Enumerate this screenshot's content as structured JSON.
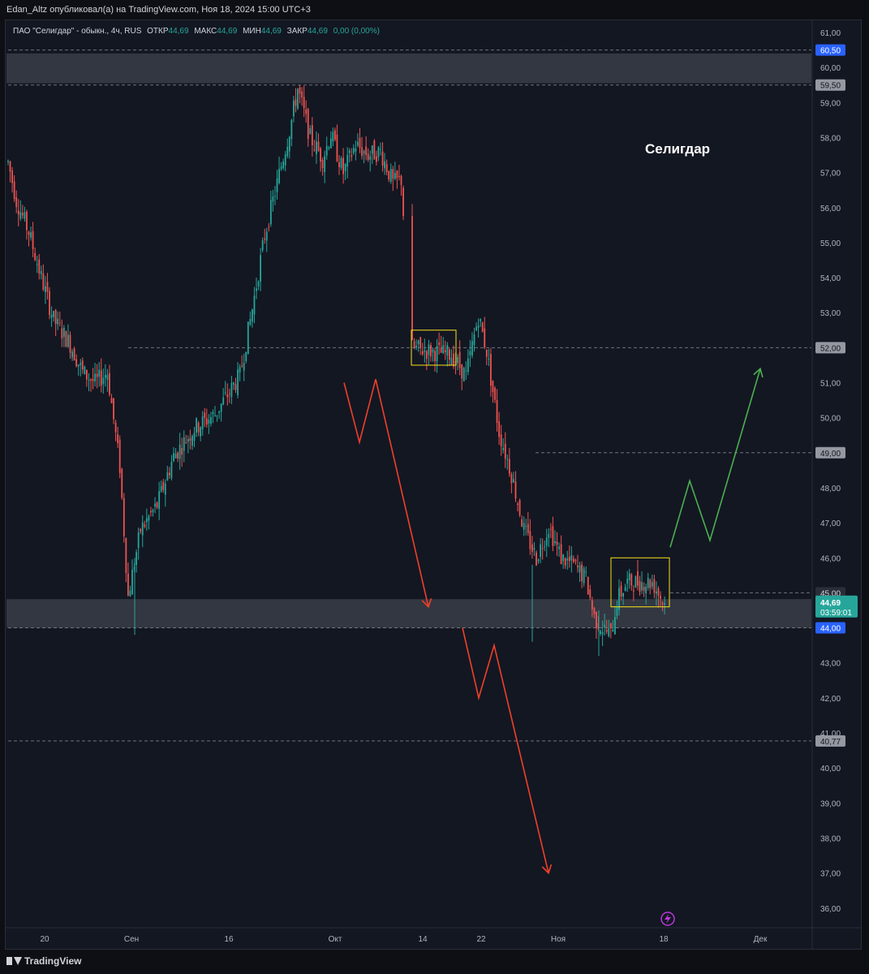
{
  "header": {
    "publisher_line": "Edan_Altz опубликовал(а) на TradingView.com, Ноя 18, 2024 15:00 UTC+3"
  },
  "legend": {
    "symbol": "ПАО \"Селигдар\" - обыкн., 4ч, RUS",
    "open_label": "ОТКР",
    "open_value": "44,69",
    "high_label": "МАКС",
    "high_value": "44,69",
    "low_label": "МИН",
    "low_value": "44,69",
    "close_label": "ЗАКР",
    "close_value": "44,69",
    "change": "0,00 (0,00%)"
  },
  "annotation": {
    "title": "Селигдар"
  },
  "footer": {
    "brand": "TradingView"
  },
  "colors": {
    "background": "#131722",
    "up": "#26a69a",
    "down": "#ef5350",
    "arrow_down": "#f0402a",
    "arrow_up": "#4caf50",
    "box": "#f7e11b",
    "price_tag": "#26a69a",
    "blue_tag": "#2962ff"
  },
  "chart_data": {
    "type": "candlestick",
    "timeframe": "4ч",
    "y_axis": {
      "range": [
        35.5,
        61.5
      ],
      "ticks": [
        "61,00",
        "60,00",
        "59,00",
        "58,00",
        "57,00",
        "56,00",
        "55,00",
        "54,00",
        "53,00",
        "52,00",
        "51,00",
        "50,00",
        "49,00",
        "48,00",
        "47,00",
        "46,00",
        "45,00",
        "44,00",
        "43,00",
        "42,00",
        "41,00",
        "40,00",
        "39,00",
        "38,00",
        "37,00",
        "36,00"
      ]
    },
    "x_axis": {
      "ticks": [
        "20",
        "Сен",
        "16",
        "Окт",
        "14",
        "22",
        "Ноя",
        "18",
        "Дек"
      ]
    },
    "price_levels": [
      {
        "label": "60,50",
        "value": 60.5,
        "style": "highlight"
      },
      {
        "label": "59,50",
        "value": 59.5,
        "style": "grey"
      },
      {
        "label": "52,00",
        "value": 52.0,
        "style": "grey"
      },
      {
        "label": "49,00",
        "value": 49.0,
        "style": "grey"
      },
      {
        "label": "45,00",
        "value": 45.0,
        "style": "dark"
      },
      {
        "label": "44,00",
        "value": 44.0,
        "style": "highlight"
      },
      {
        "label": "40,77",
        "value": 40.77,
        "style": "grey"
      }
    ],
    "current_price": {
      "value": "44,69",
      "countdown": "03:59:01"
    },
    "zones": [
      {
        "name": "resistance-zone",
        "from": 59.55,
        "to": 60.4
      },
      {
        "name": "support-zone",
        "from": 44.0,
        "to": 44.82
      }
    ],
    "price_path": [
      [
        0,
        57.3
      ],
      [
        4,
        56.2
      ],
      [
        10,
        55.3
      ],
      [
        16,
        54.0
      ],
      [
        22,
        52.8
      ],
      [
        30,
        52.1
      ],
      [
        36,
        51.3
      ],
      [
        42,
        51.0
      ],
      [
        48,
        51.3
      ],
      [
        54,
        48.6
      ],
      [
        58,
        44.9
      ],
      [
        64,
        46.8
      ],
      [
        72,
        47.5
      ],
      [
        80,
        48.9
      ],
      [
        90,
        49.7
      ],
      [
        100,
        50.1
      ],
      [
        112,
        51.2
      ],
      [
        118,
        53.1
      ],
      [
        124,
        55.2
      ],
      [
        130,
        56.7
      ],
      [
        136,
        58.2
      ],
      [
        140,
        59.4
      ],
      [
        146,
        58.0
      ],
      [
        152,
        57.4
      ],
      [
        156,
        58.1
      ],
      [
        162,
        57.0
      ],
      [
        168,
        57.8
      ],
      [
        174,
        57.5
      ],
      [
        180,
        57.6
      ],
      [
        186,
        56.7
      ],
      [
        190,
        56.8
      ],
      [
        195,
        52.0
      ],
      [
        215,
        51.8
      ],
      [
        222,
        51.2
      ],
      [
        228,
        52.9
      ],
      [
        232,
        51.9
      ],
      [
        238,
        49.6
      ],
      [
        244,
        48.4
      ],
      [
        250,
        46.8
      ],
      [
        256,
        46.0
      ],
      [
        262,
        46.9
      ],
      [
        268,
        46.0
      ],
      [
        274,
        45.8
      ],
      [
        280,
        45.4
      ],
      [
        284,
        44.3
      ],
      [
        288,
        44.0
      ],
      [
        292,
        43.8
      ],
      [
        295,
        44.8
      ],
      [
        300,
        45.3
      ],
      [
        306,
        45.3
      ],
      [
        312,
        45.3
      ],
      [
        318,
        44.69
      ]
    ],
    "drawings": [
      {
        "name": "bearish-arrow-1",
        "color": "red",
        "points": [
          [
            51.0
          ],
          [
            49.3
          ],
          [
            51.1
          ],
          [
            44.6
          ]
        ]
      },
      {
        "name": "bearish-arrow-2",
        "color": "red",
        "points": [
          [
            44.0
          ],
          [
            42.0
          ],
          [
            43.5
          ],
          [
            37.0
          ]
        ]
      },
      {
        "name": "bullish-arrow",
        "color": "green",
        "points": [
          [
            46.3
          ],
          [
            48.2
          ],
          [
            46.5
          ],
          [
            51.4
          ]
        ]
      }
    ],
    "boxes": [
      {
        "name": "consolidation-box-1",
        "from": 51.5,
        "to": 52.5
      },
      {
        "name": "consolidation-box-2",
        "from": 44.6,
        "to": 46.0
      }
    ]
  }
}
